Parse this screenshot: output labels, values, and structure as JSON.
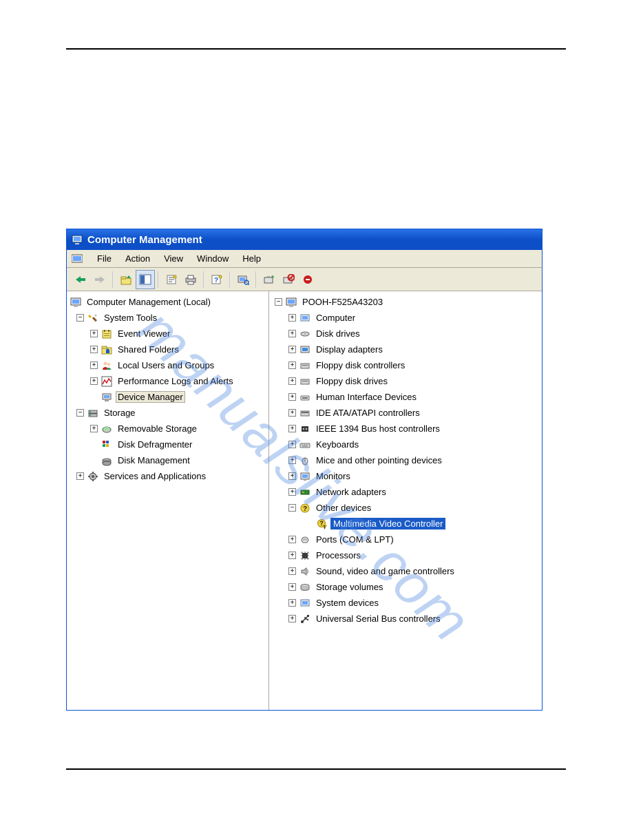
{
  "watermark": "manualslive.com",
  "title": "Computer Management",
  "menus": {
    "file": "File",
    "action": "Action",
    "view": "View",
    "window": "Window",
    "help": "Help"
  },
  "left": {
    "root": "Computer Management (Local)",
    "systools": "System Tools",
    "eventviewer": "Event Viewer",
    "sharedfolders": "Shared Folders",
    "localusers": "Local Users and Groups",
    "perflogs": "Performance Logs and Alerts",
    "devmgr": "Device Manager",
    "storage": "Storage",
    "removable": "Removable Storage",
    "defrag": "Disk Defragmenter",
    "diskmgmt": "Disk Management",
    "services": "Services and Applications"
  },
  "right": {
    "root": "POOH-F525A43203",
    "computer": "Computer",
    "diskdrives": "Disk drives",
    "display": "Display adapters",
    "floppyctrl": "Floppy disk controllers",
    "floppydrv": "Floppy disk drives",
    "hid": "Human Interface Devices",
    "ide": "IDE ATA/ATAPI controllers",
    "ieee": "IEEE 1394 Bus host controllers",
    "keyboards": "Keyboards",
    "mice": "Mice and other pointing devices",
    "monitors": "Monitors",
    "network": "Network adapters",
    "other": "Other devices",
    "multimedia": "Multimedia Video Controller",
    "ports": "Ports (COM & LPT)",
    "processors": "Processors",
    "sound": "Sound, video and game controllers",
    "storagevol": "Storage volumes",
    "sysdev": "System devices",
    "usb": "Universal Serial Bus controllers"
  }
}
